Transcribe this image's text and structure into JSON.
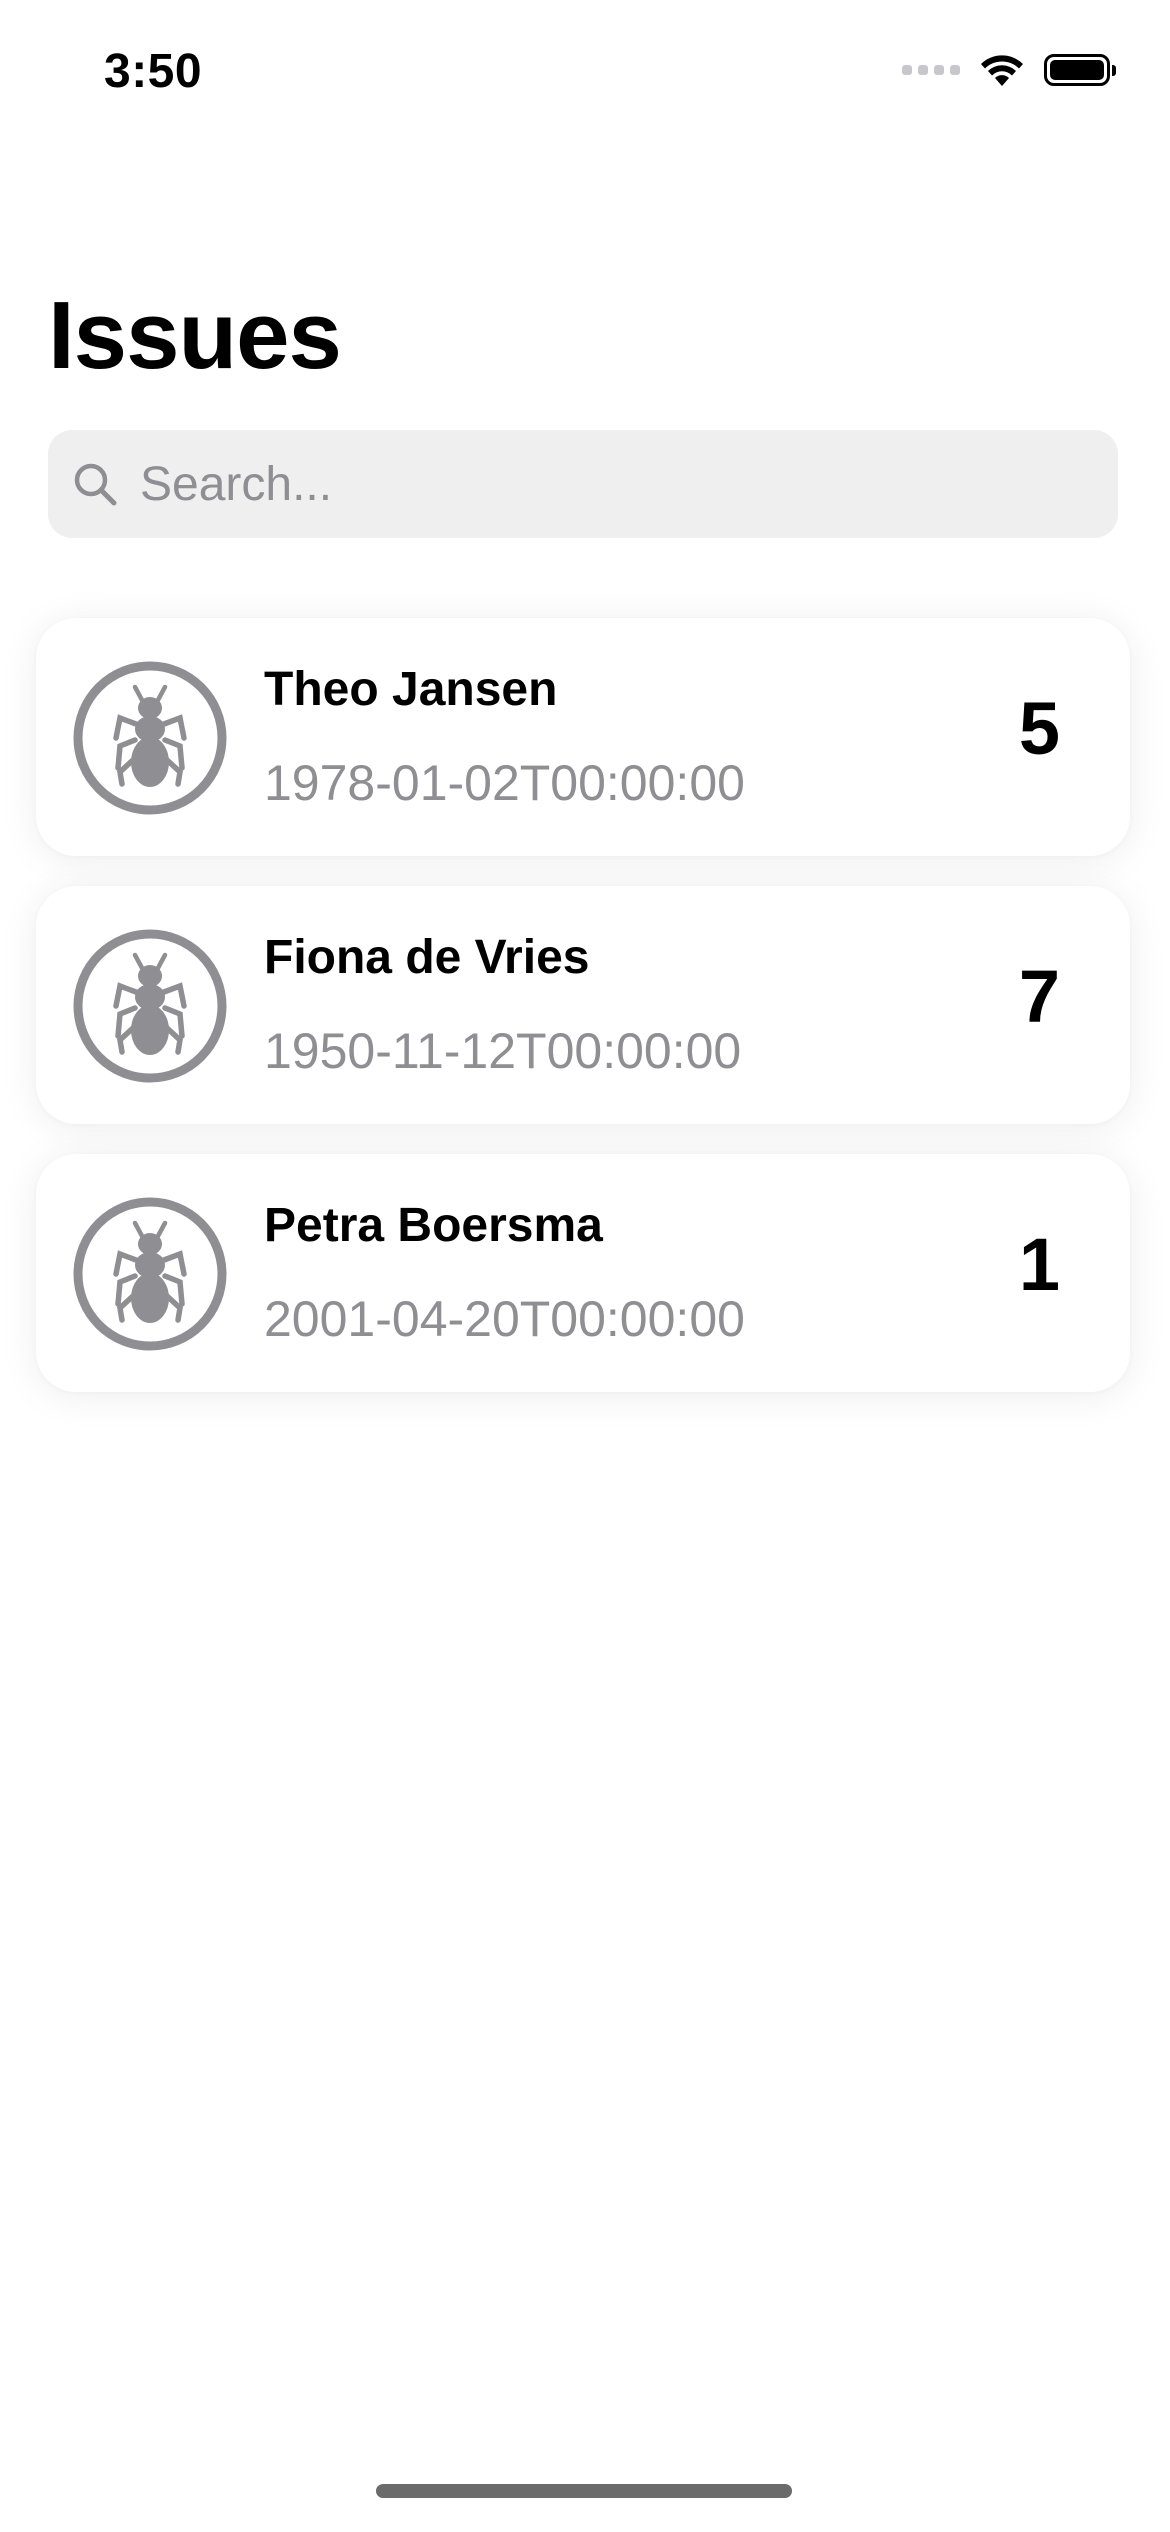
{
  "status_bar": {
    "time": "3:50"
  },
  "page": {
    "title": "Issues"
  },
  "search": {
    "placeholder": "Search...",
    "value": ""
  },
  "issues": [
    {
      "name": "Theo Jansen",
      "date": "1978-01-02T00:00:00",
      "count": "5",
      "icon": "ant-icon"
    },
    {
      "name": "Fiona de Vries",
      "date": "1950-11-12T00:00:00",
      "count": "7",
      "icon": "ant-icon"
    },
    {
      "name": "Petra Boersma",
      "date": "2001-04-20T00:00:00",
      "count": "1",
      "icon": "ant-icon"
    }
  ],
  "colors": {
    "icon_gray": "#8e8e93",
    "search_bg": "#efefef",
    "secondary_text": "#8e8e93"
  }
}
